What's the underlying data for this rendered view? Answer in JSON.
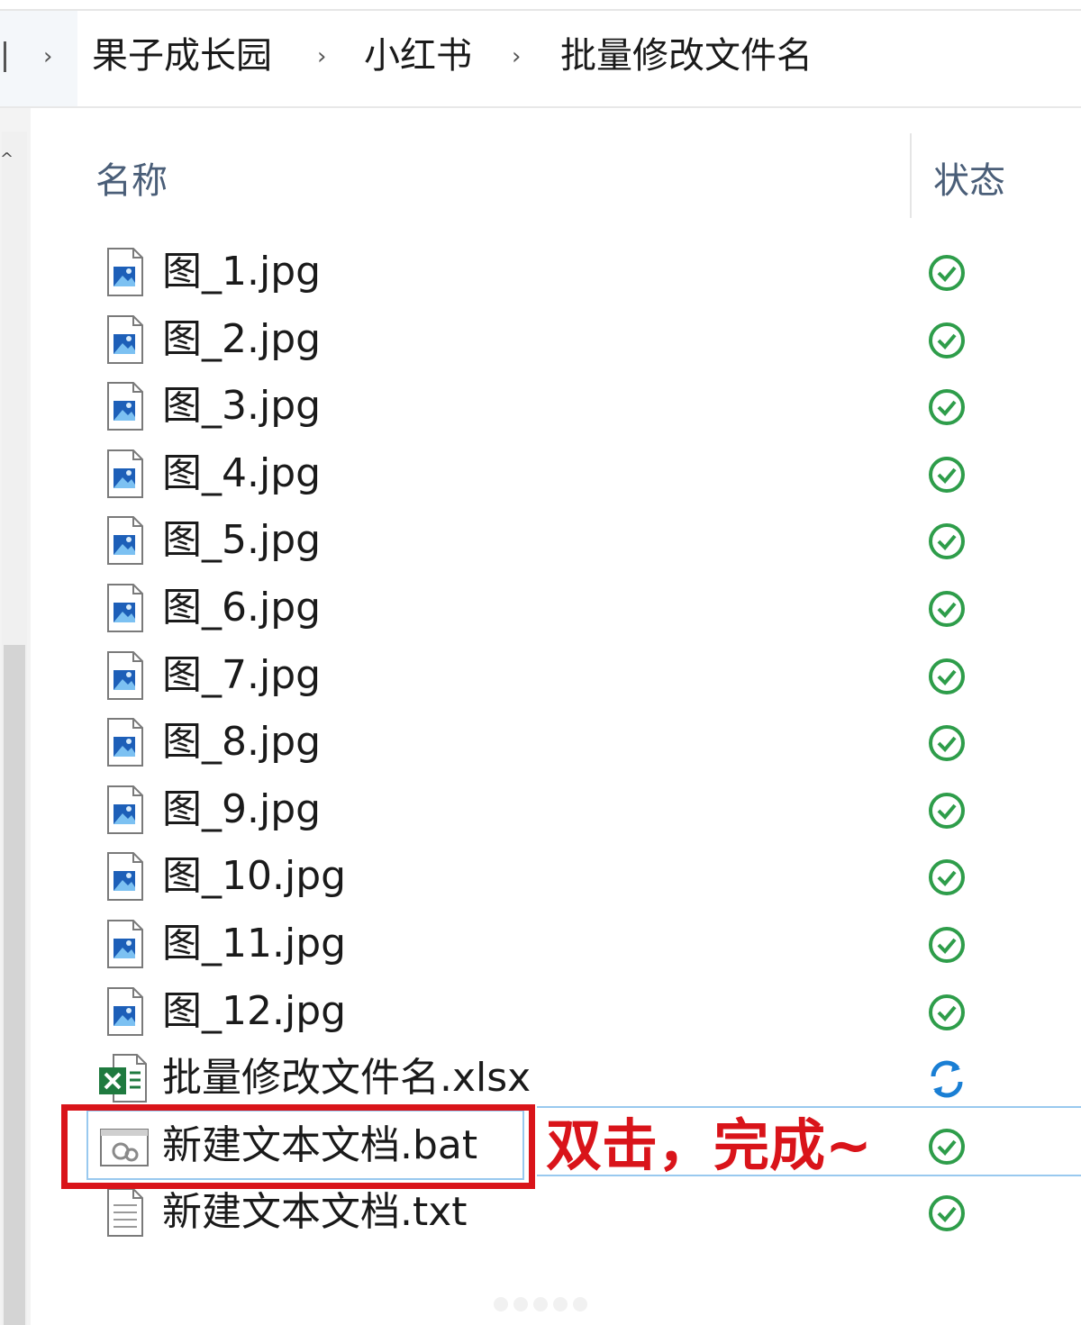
{
  "breadcrumb": {
    "items": [
      "果子成长园",
      "小红书",
      "批量修改文件名"
    ]
  },
  "columns": {
    "name": "名称",
    "status": "状态"
  },
  "files": [
    {
      "name": "图_1.jpg",
      "type": "image",
      "status": "synced"
    },
    {
      "name": "图_2.jpg",
      "type": "image",
      "status": "synced"
    },
    {
      "name": "图_3.jpg",
      "type": "image",
      "status": "synced"
    },
    {
      "name": "图_4.jpg",
      "type": "image",
      "status": "synced"
    },
    {
      "name": "图_5.jpg",
      "type": "image",
      "status": "synced"
    },
    {
      "name": "图_6.jpg",
      "type": "image",
      "status": "synced"
    },
    {
      "name": "图_7.jpg",
      "type": "image",
      "status": "synced"
    },
    {
      "name": "图_8.jpg",
      "type": "image",
      "status": "synced"
    },
    {
      "name": "图_9.jpg",
      "type": "image",
      "status": "synced"
    },
    {
      "name": "图_10.jpg",
      "type": "image",
      "status": "synced"
    },
    {
      "name": "图_11.jpg",
      "type": "image",
      "status": "synced"
    },
    {
      "name": "图_12.jpg",
      "type": "image",
      "status": "synced"
    },
    {
      "name": "批量修改文件名.xlsx",
      "type": "excel",
      "status": "syncing"
    },
    {
      "name": "新建文本文档.bat",
      "type": "batch",
      "status": "synced",
      "selected": true
    },
    {
      "name": "新建文本文档.txt",
      "type": "text",
      "status": "synced"
    }
  ],
  "annotation": {
    "text": "双击，完成~",
    "color": "#d9141a"
  },
  "colors": {
    "synced": "#2e9d4a",
    "syncing": "#1a7fd4",
    "selection": "#99c9ef",
    "header_text": "#4a5e78"
  }
}
